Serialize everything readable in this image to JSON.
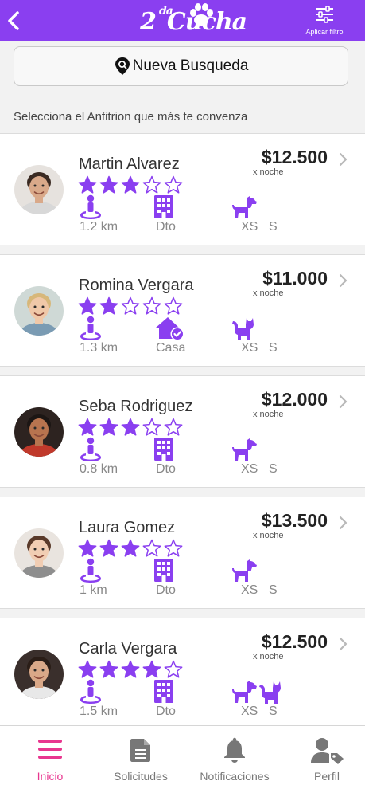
{
  "header": {
    "logo_text": "2da Cucha",
    "logo_main": "2",
    "logo_sup": "da",
    "logo_word": "Cucha",
    "filter_label": "Aplicar filtro"
  },
  "search": {
    "label": "Nueva Busqueda"
  },
  "prompt": "Selecciona el Anfitrion que más te convenza",
  "colors": {
    "accent": "#8a3ff0",
    "tab_active": "#e8368f",
    "icon_gray": "#777777"
  },
  "hosts": [
    {
      "name": "Martin Alvarez",
      "price": "$12.500",
      "per": "x noche",
      "rating": 3,
      "distance": "1.2 km",
      "property": "Dto",
      "property_icon": "building-icon",
      "pets": [
        "dog"
      ],
      "sizes": [
        "XS",
        "S"
      ]
    },
    {
      "name": "Romina Vergara",
      "price": "$11.000",
      "per": "x noche",
      "rating": 2,
      "distance": "1.3 km",
      "property": "Casa",
      "property_icon": "house-check-icon",
      "pets": [
        "cat"
      ],
      "sizes": [
        "XS",
        "S"
      ]
    },
    {
      "name": "Seba Rodriguez",
      "price": "$12.000",
      "per": "x noche",
      "rating": 3,
      "distance": "0.8 km",
      "property": "Dto",
      "property_icon": "building-icon",
      "pets": [
        "dog"
      ],
      "sizes": [
        "XS",
        "S"
      ]
    },
    {
      "name": "Laura Gomez",
      "price": "$13.500",
      "per": "x noche",
      "rating": 3,
      "distance": "1 km",
      "property": "Dto",
      "property_icon": "building-icon",
      "pets": [
        "dog"
      ],
      "sizes": [
        "XS",
        "S"
      ]
    },
    {
      "name": "Carla Vergara",
      "price": "$12.500",
      "per": "x noche",
      "rating": 4,
      "distance": "1.5 km",
      "property": "Dto",
      "property_icon": "building-icon",
      "pets": [
        "dog",
        "cat"
      ],
      "sizes": [
        "XS",
        "S"
      ]
    }
  ],
  "tabs": [
    {
      "label": "Inicio",
      "icon": "menu-icon",
      "active": true
    },
    {
      "label": "Solicitudes",
      "icon": "document-icon",
      "active": false
    },
    {
      "label": "Notificaciones",
      "icon": "bell-icon",
      "active": false
    },
    {
      "label": "Perfil",
      "icon": "user-tag-icon",
      "active": false
    }
  ]
}
